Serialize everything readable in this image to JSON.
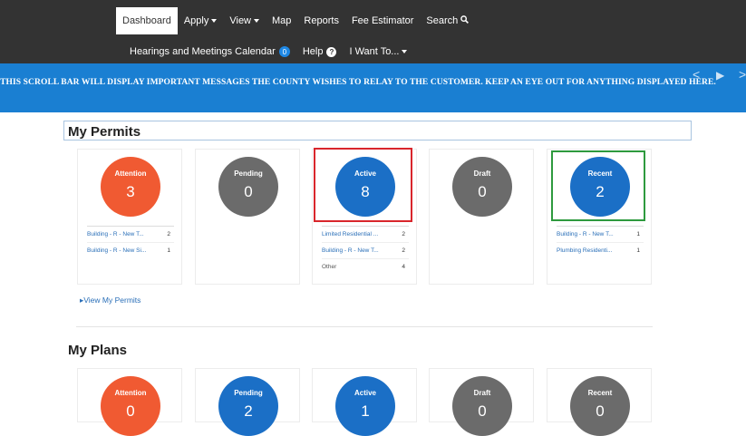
{
  "nav": {
    "row1": [
      "Dashboard",
      "Apply",
      "View",
      "Map",
      "Reports",
      "Fee Estimator",
      "Search"
    ],
    "row2_calendar": "Hearings and Meetings Calendar",
    "calendar_count": "0",
    "help": "Help",
    "help_glyph": "?",
    "iwant": "I Want To...",
    "search_icon": "search-icon"
  },
  "banner": {
    "message": "THIS SCROLL BAR WILL DISPLAY IMPORTANT MESSAGES THE COUNTY WISHES TO RELAY TO THE CUSTOMER.  KEEP AN EYE OUT FOR ANYTHING DISPLAYED HERE.",
    "prev_glyph": "<",
    "play_glyph": "▶",
    "next_glyph": ">"
  },
  "permits": {
    "title": "My Permits",
    "cards": [
      {
        "label": "Attention",
        "count": "3",
        "color": "#f05a32",
        "rows": [
          {
            "label": "Building - R - New T...",
            "count": "2"
          },
          {
            "label": "Building - R - New Si...",
            "count": "1"
          }
        ]
      },
      {
        "label": "Pending",
        "count": "0",
        "color": "#6b6b6b",
        "rows": []
      },
      {
        "label": "Active",
        "count": "8",
        "color": "#1b6fc6",
        "rows": [
          {
            "label": "Limited Residential ...",
            "count": "2"
          },
          {
            "label": "Building - R - New T...",
            "count": "2"
          },
          {
            "label": "Other",
            "count": "4"
          }
        ]
      },
      {
        "label": "Draft",
        "count": "0",
        "color": "#6b6b6b",
        "rows": []
      },
      {
        "label": "Recent",
        "count": "2",
        "color": "#1b6fc6",
        "rows": [
          {
            "label": "Building - R - New T...",
            "count": "1"
          },
          {
            "label": "Plumbing Residenti...",
            "count": "1"
          }
        ]
      }
    ],
    "view_link": "View My Permits",
    "highlight_colors": {
      "active": "#d9262c",
      "recent": "#2e9a3e"
    }
  },
  "plans": {
    "title": "My Plans",
    "cards": [
      {
        "label": "Attention",
        "count": "0",
        "color": "#f05a32"
      },
      {
        "label": "Pending",
        "count": "2",
        "color": "#1b6fc6"
      },
      {
        "label": "Active",
        "count": "1",
        "color": "#1b6fc6"
      },
      {
        "label": "Draft",
        "count": "0",
        "color": "#6b6b6b"
      },
      {
        "label": "Recent",
        "count": "0",
        "color": "#6b6b6b"
      }
    ]
  }
}
